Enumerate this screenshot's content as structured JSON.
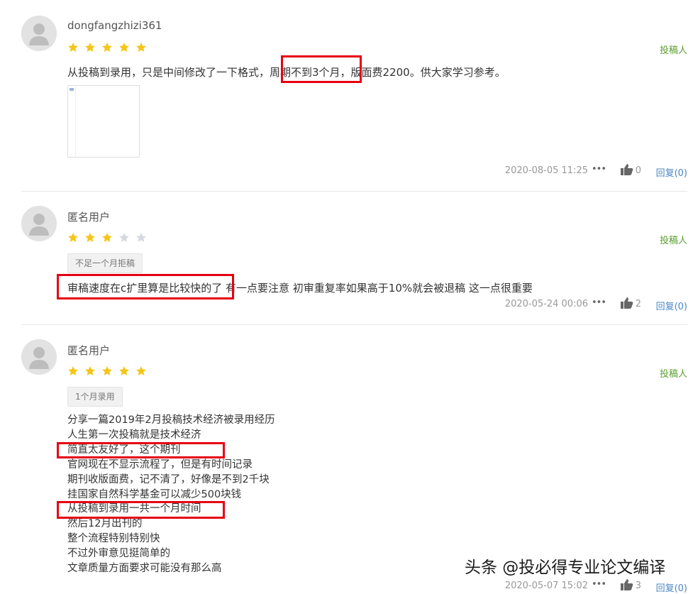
{
  "reviews": [
    {
      "username": "dongfangzhizi361",
      "rating": 5,
      "author_tag": "投稿人",
      "content": "从投稿到录用，只是中间修改了一下格式，周期不到3个月，版面费2200。供大家学习参考。",
      "timestamp": "2020-08-05 11:25",
      "more": "•••",
      "likes": "0",
      "reply": "回复(0)"
    },
    {
      "username": "匿名用户",
      "rating": 3,
      "author_tag": "投稿人",
      "tag": "不足一个月拒稿",
      "content": "审稿速度在c扩里算是比较快的了 有一点要注意 初审重复率如果高于10%就会被退稿 这一点很重要",
      "timestamp": "2020-05-24 00:06",
      "more": "•••",
      "likes": "2",
      "reply": "回复(0)"
    },
    {
      "username": "匿名用户",
      "rating": 5,
      "author_tag": "投稿人",
      "tag": "1个月录用",
      "lines": [
        "分享一篇2019年2月投稿技术经济被录用经历",
        "人生第一次投稿就是技术经济",
        "简直太友好了，这个期刊",
        "官网现在不显示流程了，但是有时间记录",
        "期刊收版面费，记不清了，好像是不到2千块",
        "挂国家自然科学基金可以减少500块钱",
        "从投稿到录用一共一个月时间",
        "然后12月出刊的",
        "整个流程特别特别快",
        "不过外审意见挺简单的",
        "文章质量方面要求可能没有那么高"
      ],
      "timestamp": "2020-05-07 15:02",
      "more": "•••",
      "likes": "3",
      "reply": "回复(0)"
    }
  ],
  "colors": {
    "star_on": "#f5c518",
    "star_off": "#d6d9e0",
    "author_tag": "#5a9e2f",
    "reply_link": "#4a86c5",
    "highlight_box": "#e60012"
  },
  "icons": {
    "avatar": "avatar-icon",
    "like": "thumbs-up-icon",
    "more": "more-dots-icon",
    "star": "star-icon"
  },
  "watermark": "头条 @投必得专业论文编译"
}
